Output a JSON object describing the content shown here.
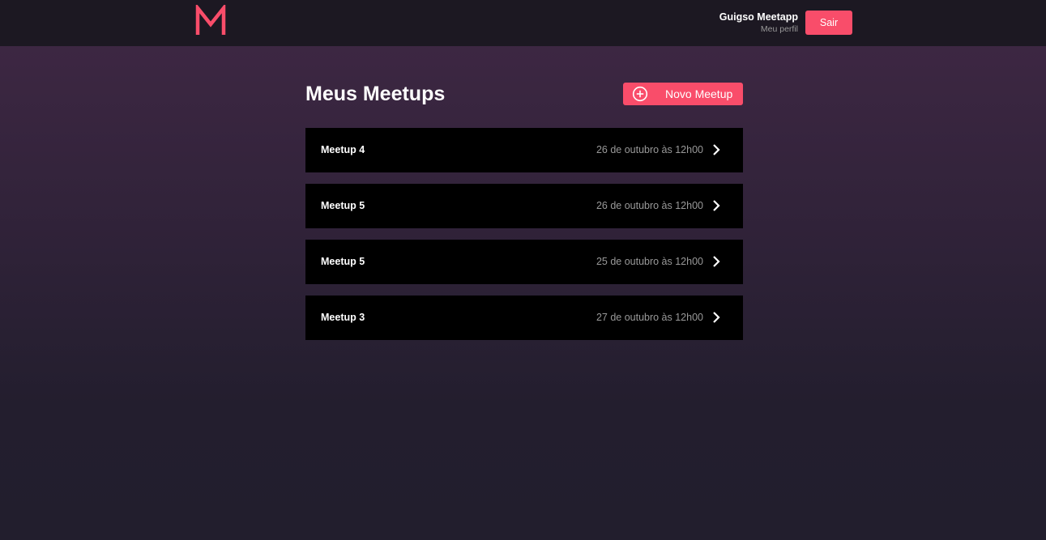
{
  "header": {
    "logo_letter": "M",
    "user_name": "Guigso Meetapp",
    "profile_link": "Meu perfil",
    "logout_label": "Sair"
  },
  "main": {
    "title": "Meus Meetups",
    "new_button_label": "Novo Meetup",
    "meetups": [
      {
        "title": "Meetup 4",
        "date": "26 de outubro às 12h00"
      },
      {
        "title": "Meetup 5",
        "date": "26 de outubro às 12h00"
      },
      {
        "title": "Meetup 5",
        "date": "25 de outubro às 12h00"
      },
      {
        "title": "Meetup 3",
        "date": "27 de outubro às 12h00"
      }
    ]
  },
  "colors": {
    "accent": "#f94d6a",
    "header_bg": "#1c1822",
    "card_bg": "#000000",
    "muted_text": "#999999"
  },
  "icons": {
    "logo": "meetapp-logo-icon",
    "new_button": "plus-circle-icon",
    "row_action": "chevron-right-icon"
  }
}
